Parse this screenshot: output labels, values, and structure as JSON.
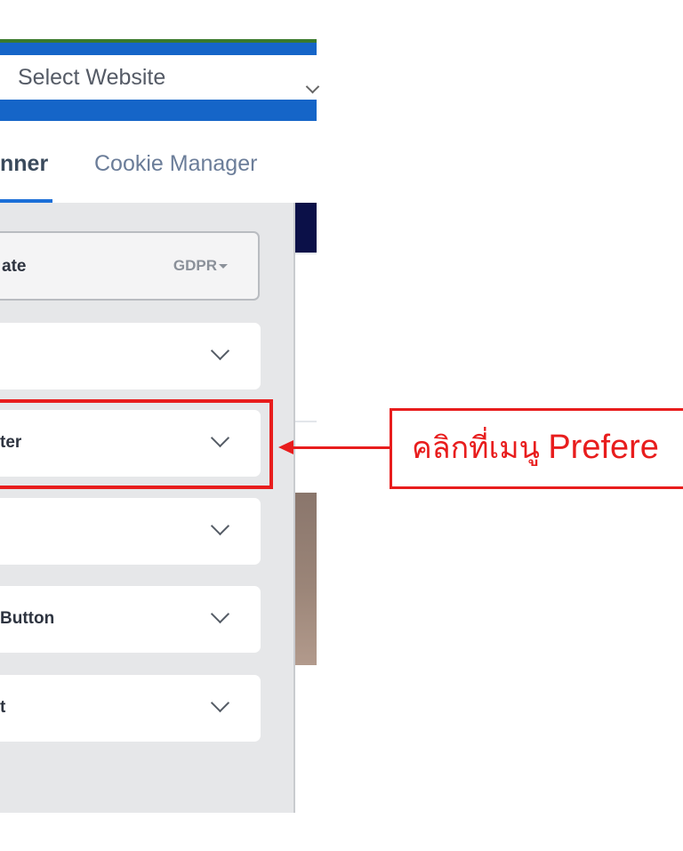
{
  "header": {
    "select_placeholder": "Select Website"
  },
  "tabs": [
    {
      "label": "nner",
      "active": true
    },
    {
      "label": "Cookie Manager",
      "active": false
    }
  ],
  "panel": {
    "template": {
      "label": "ate",
      "value": "GDPR"
    },
    "cards": [
      {
        "label": ""
      },
      {
        "label": "ter"
      },
      {
        "label": ""
      },
      {
        "label": " Button"
      },
      {
        "label": "t"
      }
    ]
  },
  "annotation": {
    "thai": "คลิกที่เมนู ",
    "english": "Prefere",
    "color": "#e81d1d"
  },
  "colors": {
    "accent": "#1565c8",
    "annotation": "#e81d1d",
    "panel_bg": "#e6e7e9",
    "preview_header": "#0b1048"
  }
}
